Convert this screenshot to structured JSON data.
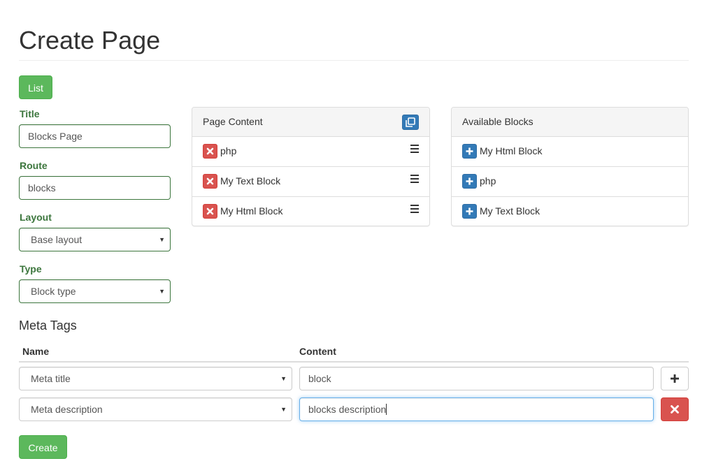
{
  "page": {
    "title": "Create Page"
  },
  "toolbar": {
    "list_label": "List"
  },
  "form": {
    "title": {
      "label": "Title",
      "value": "Blocks Page"
    },
    "route": {
      "label": "Route",
      "value": "blocks"
    },
    "layout": {
      "label": "Layout",
      "selected": "Base layout"
    },
    "type": {
      "label": "Type",
      "selected": "Block type"
    }
  },
  "page_content": {
    "heading": "Page Content",
    "items": [
      {
        "label": "php"
      },
      {
        "label": "My Text Block"
      },
      {
        "label": "My Html Block"
      }
    ]
  },
  "available_blocks": {
    "heading": "Available Blocks",
    "items": [
      {
        "label": "My Html Block"
      },
      {
        "label": "php"
      },
      {
        "label": "My Text Block"
      }
    ]
  },
  "meta_tags": {
    "title": "Meta Tags",
    "columns": {
      "name": "Name",
      "content": "Content"
    },
    "rows": [
      {
        "name": "Meta title",
        "content": "block"
      },
      {
        "name": "Meta description",
        "content": "blocks description"
      }
    ]
  },
  "footer": {
    "create_label": "Create"
  },
  "colors": {
    "success": "#5cb85c",
    "primary": "#337ab7",
    "danger": "#d9534f",
    "label_green": "#3c763d",
    "focus": "#66afe9"
  },
  "icons": {
    "remove": "times-icon",
    "add": "plus-icon",
    "drag": "hamburger-icon",
    "copy": "copy-icon"
  }
}
